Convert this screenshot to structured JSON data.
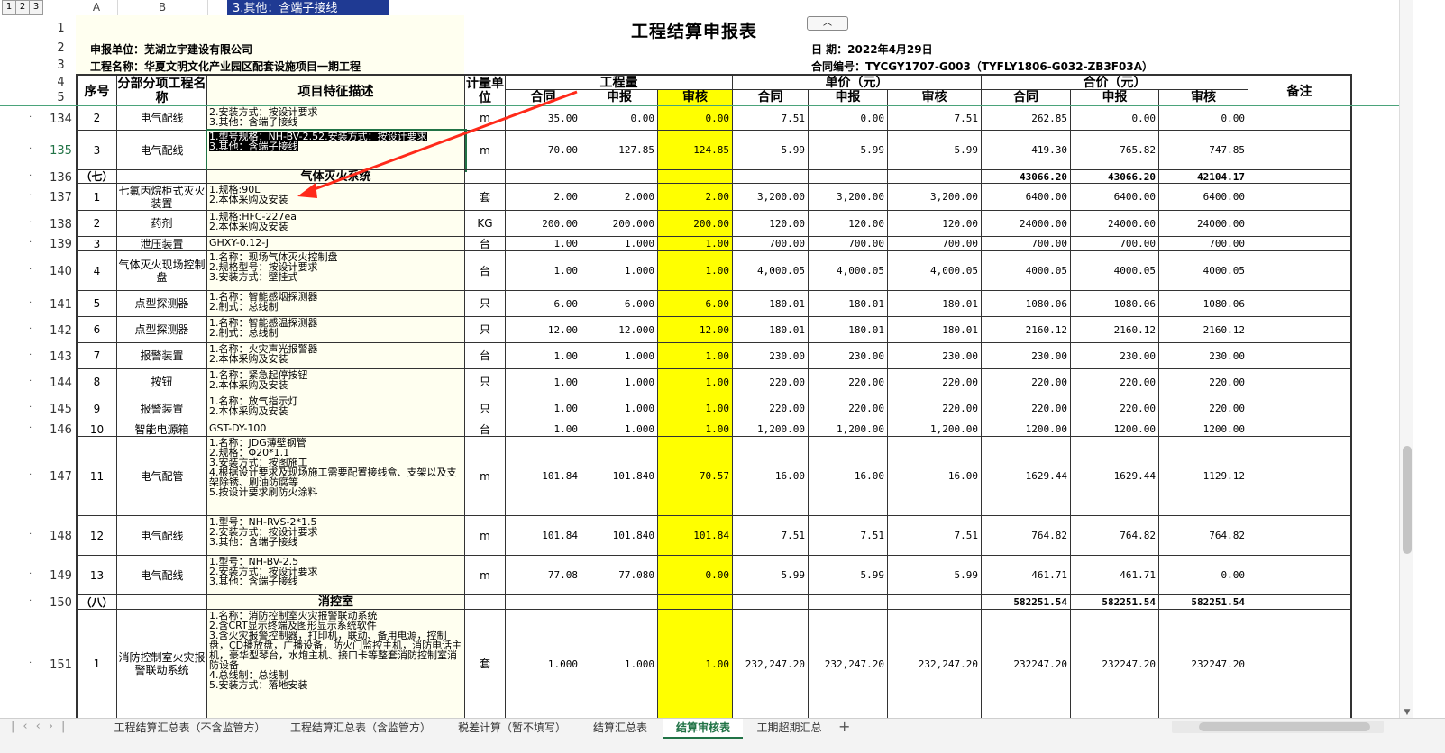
{
  "outline_levels": [
    "1",
    "2",
    "3"
  ],
  "col_letters": [
    "A",
    "B"
  ],
  "tooltip_line": "3.其他：含端子接线",
  "title": "工程结算申报表",
  "header": {
    "unit_label": "申报单位：芜湖立宇建设有限公司",
    "project_label": "工程名称：华夏文明文化产业园区配套设施项目一期工程",
    "date_label": "日      期：2022年4月29日",
    "contract_label": "合同编号：TYCGY1707-G003（TYFLY1806-G032-ZB3F03A）"
  },
  "columns": {
    "seq": "序号",
    "category": "分部分项工程名称",
    "desc": "项目特征描述",
    "unit": "计量单位",
    "qty_group": "工程量",
    "price_group": "单价（元）",
    "total_group": "合价（元）",
    "remark": "备注",
    "contract": "合同",
    "declared": "申报",
    "audited": "审核"
  },
  "row_numbers": {
    "r1": "1",
    "r2": "2",
    "r3": "3",
    "r4": "4",
    "r5": "5"
  },
  "rows": [
    {
      "rn": "134",
      "seq": "2",
      "name": "电气配线",
      "desc": [
        "2.安装方式：按设计要求",
        "3.其他：含端子接线"
      ],
      "unit": "m",
      "q1": "35.00",
      "q2": "0.00",
      "q3": "0.00",
      "p1": "7.51",
      "p2": "0.00",
      "p3": "7.51",
      "t1": "262.85",
      "t2": "0.00",
      "t3": "0.00"
    },
    {
      "rn": "135",
      "seq": "3",
      "name": "电气配线",
      "desc": [
        "1.型号规格：NH-BV-2.5",
        "2.安装方式：按设计要求",
        "3.其他：含端子接线"
      ],
      "unit": "m",
      "q1": "70.00",
      "q2": "127.85",
      "q3": "124.85",
      "p1": "5.99",
      "p2": "5.99",
      "p3": "5.99",
      "t1": "419.30",
      "t2": "765.82",
      "t3": "747.85"
    },
    {
      "rn": "136",
      "seq": "（七）",
      "name": "",
      "desc": [
        "气体灭火系统"
      ],
      "unit": "",
      "q1": "",
      "q2": "",
      "q3": "",
      "p1": "",
      "p2": "",
      "p3": "",
      "t1": "43066.20",
      "t2": "43066.20",
      "t3": "42104.17"
    },
    {
      "rn": "137",
      "seq": "1",
      "name": "七氟丙烷柜式灭火装置",
      "desc": [
        "1.规格:90L",
        "2.本体采购及安装"
      ],
      "unit": "套",
      "q1": "2.00",
      "q2": "2.000",
      "q3": "2.00",
      "p1": "3,200.00",
      "p2": "3,200.00",
      "p3": "3,200.00",
      "t1": "6400.00",
      "t2": "6400.00",
      "t3": "6400.00"
    },
    {
      "rn": "138",
      "seq": "2",
      "name": "药剂",
      "desc": [
        "1.规格:HFC-227ea",
        "2.本体采购及安装"
      ],
      "unit": "KG",
      "q1": "200.00",
      "q2": "200.000",
      "q3": "200.00",
      "p1": "120.00",
      "p2": "120.00",
      "p3": "120.00",
      "t1": "24000.00",
      "t2": "24000.00",
      "t3": "24000.00"
    },
    {
      "rn": "139",
      "seq": "3",
      "name": "泄压装置",
      "desc": [
        "GHXY-0.12-J"
      ],
      "unit": "台",
      "q1": "1.00",
      "q2": "1.000",
      "q3": "1.00",
      "p1": "700.00",
      "p2": "700.00",
      "p3": "700.00",
      "t1": "700.00",
      "t2": "700.00",
      "t3": "700.00"
    },
    {
      "rn": "140",
      "seq": "4",
      "name": "气体灭火现场控制盘",
      "desc": [
        "1.名称：现场气体灭火控制盘",
        "2.规格型号：按设计要求",
        "3.安装方式：壁挂式"
      ],
      "unit": "台",
      "q1": "1.00",
      "q2": "1.000",
      "q3": "1.00",
      "p1": "4,000.05",
      "p2": "4,000.05",
      "p3": "4,000.05",
      "t1": "4000.05",
      "t2": "4000.05",
      "t3": "4000.05"
    },
    {
      "rn": "141",
      "seq": "5",
      "name": "点型探测器",
      "desc": [
        "1.名称：智能感烟探测器",
        "2.制式：总线制"
      ],
      "unit": "只",
      "q1": "6.00",
      "q2": "6.000",
      "q3": "6.00",
      "p1": "180.01",
      "p2": "180.01",
      "p3": "180.01",
      "t1": "1080.06",
      "t2": "1080.06",
      "t3": "1080.06"
    },
    {
      "rn": "142",
      "seq": "6",
      "name": "点型探测器",
      "desc": [
        "1.名称：智能感温探测器",
        "2.制式：总线制"
      ],
      "unit": "只",
      "q1": "12.00",
      "q2": "12.000",
      "q3": "12.00",
      "p1": "180.01",
      "p2": "180.01",
      "p3": "180.01",
      "t1": "2160.12",
      "t2": "2160.12",
      "t3": "2160.12"
    },
    {
      "rn": "143",
      "seq": "7",
      "name": "报警装置",
      "desc": [
        "1.名称：火灾声光报警器",
        "2.本体采购及安装"
      ],
      "unit": "台",
      "q1": "1.00",
      "q2": "1.000",
      "q3": "1.00",
      "p1": "230.00",
      "p2": "230.00",
      "p3": "230.00",
      "t1": "230.00",
      "t2": "230.00",
      "t3": "230.00"
    },
    {
      "rn": "144",
      "seq": "8",
      "name": "按钮",
      "desc": [
        "1.名称：紧急起停按钮",
        "2.本体采购及安装"
      ],
      "unit": "只",
      "q1": "1.00",
      "q2": "1.000",
      "q3": "1.00",
      "p1": "220.00",
      "p2": "220.00",
      "p3": "220.00",
      "t1": "220.00",
      "t2": "220.00",
      "t3": "220.00"
    },
    {
      "rn": "145",
      "seq": "9",
      "name": "报警装置",
      "desc": [
        "1.名称：放气指示灯",
        "2.本体采购及安装"
      ],
      "unit": "只",
      "q1": "1.00",
      "q2": "1.000",
      "q3": "1.00",
      "p1": "220.00",
      "p2": "220.00",
      "p3": "220.00",
      "t1": "220.00",
      "t2": "220.00",
      "t3": "220.00"
    },
    {
      "rn": "146",
      "seq": "10",
      "name": "智能电源箱",
      "desc": [
        "GST-DY-100"
      ],
      "unit": "台",
      "q1": "1.00",
      "q2": "1.000",
      "q3": "1.00",
      "p1": "1,200.00",
      "p2": "1,200.00",
      "p3": "1,200.00",
      "t1": "1200.00",
      "t2": "1200.00",
      "t3": "1200.00"
    },
    {
      "rn": "147",
      "seq": "11",
      "name": "电气配管",
      "desc": [
        "1.名称：JDG薄壁钢管",
        "2.规格：Φ20*1.1",
        "3.安装方式：按图施工",
        "4.根据设计要求及现场施工需要配置接线盒、支架以及支架除锈、刷油防腐等",
        "5.按设计要求刷防火涂料"
      ],
      "unit": "m",
      "q1": "101.84",
      "q2": "101.840",
      "q3": "70.57",
      "p1": "16.00",
      "p2": "16.00",
      "p3": "16.00",
      "t1": "1629.44",
      "t2": "1629.44",
      "t3": "1129.12"
    },
    {
      "rn": "148",
      "seq": "12",
      "name": "电气配线",
      "desc": [
        "1.型号：NH-RVS-2*1.5",
        "2.安装方式：按设计要求",
        "3.其他：含端子接线"
      ],
      "unit": "m",
      "q1": "101.84",
      "q2": "101.840",
      "q3": "101.84",
      "p1": "7.51",
      "p2": "7.51",
      "p3": "7.51",
      "t1": "764.82",
      "t2": "764.82",
      "t3": "764.82"
    },
    {
      "rn": "149",
      "seq": "13",
      "name": "电气配线",
      "desc": [
        "1.型号：NH-BV-2.5",
        "2.安装方式：按设计要求",
        "3.其他：含端子接线"
      ],
      "unit": "m",
      "q1": "77.08",
      "q2": "77.080",
      "q3": "0.00",
      "p1": "5.99",
      "p2": "5.99",
      "p3": "5.99",
      "t1": "461.71",
      "t2": "461.71",
      "t3": "0.00"
    },
    {
      "rn": "150",
      "seq": "（八）",
      "name": "",
      "desc": [
        "消控室"
      ],
      "unit": "",
      "q1": "",
      "q2": "",
      "q3": "",
      "p1": "",
      "p2": "",
      "p3": "",
      "t1": "582251.54",
      "t2": "582251.54",
      "t3": "582251.54"
    },
    {
      "rn": "151",
      "seq": "1",
      "name": "消防控制室火灾报警联动系统",
      "desc": [
        "1.名称：消防控制室火灾报警联动系统",
        "2.含CRT显示终端及图形显示系统软件",
        "3.含火灾报警控制器，打印机，联动、备用电源，控制盘，CD播放盘，广播设备，防火门监控主机，消防电话主机，豪华型琴台，水炮主机、接口卡等整套消防控制室消防设备",
        "4.总线制：总线制",
        "5.安装方式：落地安装"
      ],
      "unit": "套",
      "q1": "1.000",
      "q2": "1.000",
      "q3": "1.00",
      "p1": "232,247.20",
      "p2": "232,247.20",
      "p3": "232,247.20",
      "t1": "232247.20",
      "t2": "232247.20",
      "t3": "232247.20"
    }
  ],
  "tabs": [
    "工程结算汇总表（不含监管方）",
    "工程结算汇总表（含监管方）",
    "税差计算（暂不填写）",
    "结算汇总表",
    "结算审核表",
    "工期超期汇总"
  ],
  "active_tab": "结算审核表",
  "accent": "#217346"
}
